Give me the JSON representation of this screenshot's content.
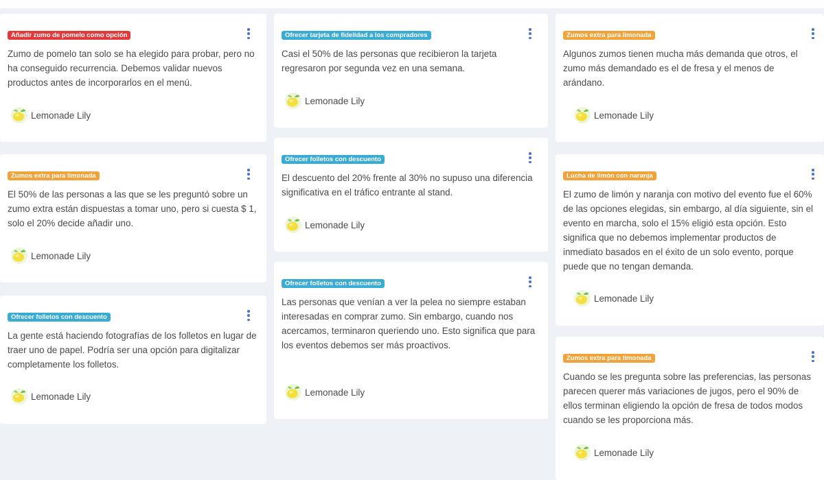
{
  "colors": {
    "red": "#e03a3a",
    "blue": "#3aabd2",
    "orange": "#f0a23b",
    "kebab": "#4d73c9"
  },
  "author": "Lemonade Lily",
  "cards": [
    {
      "tag": "Añadir zumo de pomelo como opción",
      "tag_color": "red",
      "text": "Zumo de pomelo tan solo se ha elegido para probar, pero no ha conseguido recurrencia. Debemos validar nuevos productos antes de incorporarlos en el menú."
    },
    {
      "tag": "Zumos extra para limonada",
      "tag_color": "orange",
      "text": "El 50% de las personas a las que se les preguntó sobre un zumo extra están dispuestas a tomar uno, pero si cuesta $ 1, solo el 20% decide añadir uno."
    },
    {
      "tag": "Ofrecer folletos con descuento",
      "tag_color": "blue",
      "text": "La gente está haciendo fotografías de los folletos en lugar de traer uno de papel. Podría ser una opción para digitalizar completamente los folletos."
    },
    {
      "tag": "Ofrecer tarjeta de fidelidad a los compradores",
      "tag_color": "blue",
      "text": "Casi el 50% de las personas que recibieron la tarjeta regresaron por segunda vez en una semana."
    },
    {
      "tag": "Ofrecer folletos con descuento",
      "tag_color": "blue",
      "text": "El descuento del 20% frente al 30% no supuso una diferencia significativa en el tráfico entrante al stand."
    },
    {
      "tag": "Ofrecer folletos con descuento",
      "tag_color": "blue",
      "text": "Las personas que venían a ver la pelea no siempre estaban interesadas en comprar zumo. Sin embargo, cuando nos acercamos, terminaron queriendo uno. Esto significa que para los eventos debemos ser más proactivos."
    },
    {
      "tag": "Zumos extra para limonada",
      "tag_color": "orange",
      "text": "Algunos zumos tienen mucha más demanda que otros, el zumo más demandado es el de fresa y el menos de arándano."
    },
    {
      "tag": "Lucha de limón con naranja",
      "tag_color": "orange",
      "text": "El zumo de limón y naranja con motivo del evento fue el 60% de las opciones elegidas, sin embargo, al día siguiente, sin el evento en marcha, solo el 15% eligió esta opción. Esto significa que no debemos implementar productos de inmediato basados en el éxito de un solo evento, porque puede que no tengan demanda."
    },
    {
      "tag": "Zumos extra para limonada",
      "tag_color": "orange",
      "text": "Cuando se les pregunta sobre las preferencias, las personas parecen querer más variaciones de jugos, pero el 90% de ellos terminan eligiendo la opción de fresa de todos modos cuando se les proporciona más."
    }
  ]
}
